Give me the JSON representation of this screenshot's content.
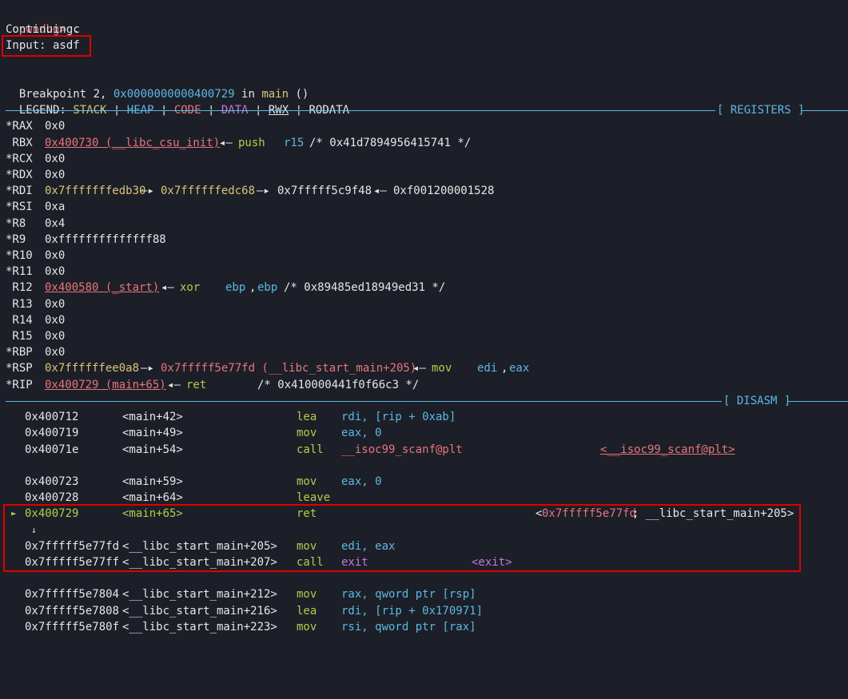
{
  "session": {
    "prompt": "pwndbg>",
    "command": "c",
    "continuing": "Continuing.",
    "input_line": "Input: asdf",
    "bp_label": "Breakpoint 2,",
    "bp_addr": "0x0000000000400729",
    "bp_in": "in",
    "bp_func": "main",
    "bp_args": "()"
  },
  "legend": {
    "label": "LEGEND:",
    "stack": "STACK",
    "heap": "HEAP",
    "code": "CODE",
    "data": "DATA",
    "rwx": "RWX",
    "rodata": "RODATA",
    "sep": "¦"
  },
  "sections": {
    "registers": "[ REGISTERS ]",
    "disasm": "[ DISASM ]"
  },
  "registers": {
    "rax": {
      "name": "*RAX",
      "val": "0x0"
    },
    "rbx": {
      "name": " RBX",
      "val": "0x400730 (__libc_csu_init)",
      "arrow": "◂—",
      "op": "push",
      "arg": "r15",
      "comment": "/* 0x41d7894956415741 */"
    },
    "rcx": {
      "name": "*RCX",
      "val": "0x0"
    },
    "rdx": {
      "name": "*RDX",
      "val": "0x0"
    },
    "rdi": {
      "name": "*RDI",
      "val": "0x7fffffffedb30",
      "a1": "—▸",
      "v2": "0x7ffffffedc68",
      "a2": "—▸",
      "v3": "0x7fffff5c9f48",
      "a3": "◂—",
      "v4": "0xf001200001528"
    },
    "rsi": {
      "name": "*RSI",
      "val": "0xa"
    },
    "r8": {
      "name": "*R8",
      "val": "0x4"
    },
    "r9": {
      "name": "*R9",
      "val": "0xffffffffffffff88"
    },
    "r10": {
      "name": "*R10",
      "val": "0x0"
    },
    "r11": {
      "name": "*R11",
      "val": "0x0"
    },
    "r12": {
      "name": " R12",
      "val": "0x400580 (_start)",
      "arrow": "◂—",
      "op": "xor",
      "arg1": "ebp",
      "comma": ",",
      "arg2": "ebp",
      "comment": "/* 0x89485ed18949ed31 */"
    },
    "r13": {
      "name": " R13",
      "val": "0x0"
    },
    "r14": {
      "name": " R14",
      "val": "0x0"
    },
    "r15": {
      "name": " R15",
      "val": "0x0"
    },
    "rbp": {
      "name": "*RBP",
      "val": "0x0"
    },
    "rsp": {
      "name": "*RSP",
      "val": "0x7ffffffee0a8",
      "a1": "—▸",
      "v2": "0x7fffff5e77fd (__libc_start_main+205)",
      "a2": "◂—",
      "op": "mov",
      "arg1": "edi",
      "comma": ",",
      "arg2": "eax"
    },
    "rip": {
      "name": "*RIP",
      "val": "0x400729 (main+65)",
      "arrow": "◂—",
      "op": "ret",
      "comment": "/* 0x410000441f0f66c3 */"
    }
  },
  "disasm": {
    "d1": {
      "addr": "0x400712",
      "sym": "<main+42>",
      "op": "lea",
      "a": "rdi, [rip + 0xab]"
    },
    "d2": {
      "addr": "0x400719",
      "sym": "<main+49>",
      "op": "mov",
      "a": "eax, 0"
    },
    "d3": {
      "addr": "0x40071e",
      "sym": "<main+54>",
      "op": "call",
      "a": "__isoc99_scanf@plt",
      "target": "<__isoc99_scanf@plt>"
    },
    "d4": {
      "addr": "0x400723",
      "sym": "<main+59>",
      "op": "mov",
      "a": "eax, 0"
    },
    "d5": {
      "addr": "0x400728",
      "sym": "<main+64>",
      "op": "leave",
      "a": ""
    },
    "d6": {
      "marker": "►",
      "addr": "0x400729",
      "sym": "<main+65>",
      "op": "ret",
      "target_open": "<",
      "target_addr": "0x7fffff5e77fd",
      "target_rest": "; __libc_start_main+205>"
    },
    "down_arrow": "↓",
    "d7": {
      "addr": "0x7fffff5e77fd",
      "sym": "<__libc_start_main+205>",
      "op": "mov",
      "a": "edi, eax"
    },
    "d8": {
      "addr": "0x7fffff5e77ff",
      "sym": "<__libc_start_main+207>",
      "op": "call",
      "a": "exit",
      "target": "<exit>"
    },
    "d9": {
      "addr": "0x7fffff5e7804",
      "sym": "<__libc_start_main+212>",
      "op": "mov",
      "a": "rax, qword ptr [rsp]"
    },
    "d10": {
      "addr": "0x7fffff5e7808",
      "sym": "<__libc_start_main+216>",
      "op": "lea",
      "a": "rdi, [rip + 0x170971]"
    },
    "d11": {
      "addr": "0x7fffff5e780f",
      "sym": "<__libc_start_main+223>",
      "op": "mov",
      "a": "rsi, qword ptr [rax]"
    }
  },
  "colors": {
    "background": "#1c1f27",
    "code": "#e8747c",
    "stack": "#dcc37a",
    "heap": "#5cb8e6",
    "data": "#c678dd",
    "instruction": "#b5cc4c",
    "highlight_box": "#e00000"
  }
}
